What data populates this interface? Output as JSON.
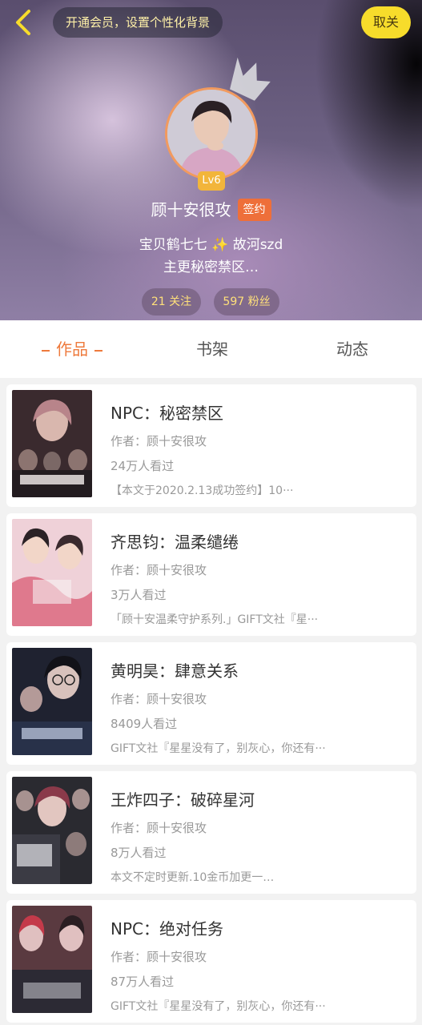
{
  "header": {
    "vip_prompt": "开通会员，设置个性化背景",
    "cancel_label": "取关",
    "level": "Lv6",
    "username": "顾十安很攻",
    "signed_tag": "签约",
    "bio_line1_a": "宝贝鹤七七",
    "bio_line1_b": "故河szd",
    "bio_line2": "主更秘密禁区…",
    "following": "21 关注",
    "fans": "597 粉丝"
  },
  "tabs": [
    {
      "label": "作品"
    },
    {
      "label": "书架"
    },
    {
      "label": "动态"
    }
  ],
  "books": [
    {
      "title": "NPC：秘密禁区",
      "author": "作者：顾十安很攻",
      "views": "24万人看过",
      "desc": "【本文于2020.2.13成功签约】10···",
      "cover_color": "#3a2a2e"
    },
    {
      "title": "齐思钧：温柔缱绻",
      "author": "作者：顾十安很攻",
      "views": "3万人看过",
      "desc": "「顾十安温柔守护系列.」GIFT文社『星···",
      "cover_color": "#e7b9c4"
    },
    {
      "title": "黄明昊：肆意关系",
      "author": "作者：顾十安很攻",
      "views": "8409人看过",
      "desc": "GIFT文社『星星没有了，别灰心，你还有···",
      "cover_color": "#1f2230"
    },
    {
      "title": "王炸四子：破碎星河",
      "author": "作者：顾十安很攻",
      "views": "8万人看过",
      "desc": "本文不定时更新.10金币加更一…",
      "cover_color": "#2a2a30"
    },
    {
      "title": "NPC：绝对任务",
      "author": "作者：顾十安很攻",
      "views": "87万人看过",
      "desc": "GIFT文社『星星没有了，别灰心，你还有···",
      "cover_color": "#5a3a40"
    }
  ],
  "colors": {
    "accent": "#ee7a3c",
    "cancel_bg": "#f7dc2b",
    "level_badge": "#f2b53b",
    "signed_tag": "#ee6f3a"
  }
}
